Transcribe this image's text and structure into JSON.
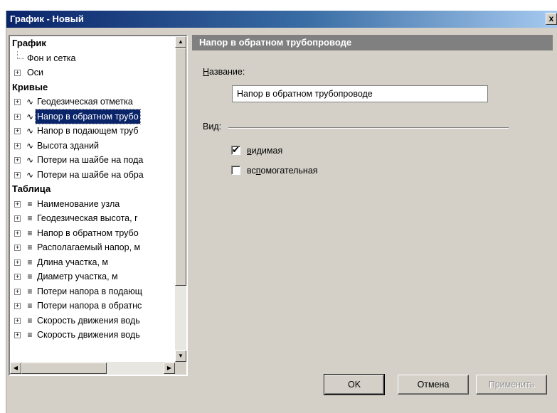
{
  "window": {
    "title": "График - Новый",
    "close_label": "x"
  },
  "tree": {
    "rows": [
      {
        "kind": "head",
        "label": "График"
      },
      {
        "kind": "leaf",
        "label": "Фон и сетка"
      },
      {
        "kind": "node",
        "icon": "",
        "label": "Оси"
      },
      {
        "kind": "head",
        "label": "Кривые"
      },
      {
        "kind": "node",
        "icon": "curve-icon",
        "label": "Геодезическая отметка"
      },
      {
        "kind": "node",
        "icon": "curve-icon",
        "label": "Напор в обратном трубо",
        "selected": true
      },
      {
        "kind": "node",
        "icon": "curve-icon",
        "label": "Напор в подающем труб"
      },
      {
        "kind": "node",
        "icon": "curve-icon",
        "label": "Высота зданий"
      },
      {
        "kind": "node",
        "icon": "curve-icon",
        "label": "Потери на шайбе на пода"
      },
      {
        "kind": "node",
        "icon": "curve-icon",
        "label": "Потери на шайбе на обра"
      },
      {
        "kind": "head",
        "label": "Таблица"
      },
      {
        "kind": "node",
        "icon": "table-row-icon",
        "label": "Наименование узла"
      },
      {
        "kind": "node",
        "icon": "table-row-icon",
        "label": "Геодезическая высота, r"
      },
      {
        "kind": "node",
        "icon": "table-row-icon",
        "label": "Напор в обратном трубо"
      },
      {
        "kind": "node",
        "icon": "table-row-icon",
        "label": "Располагаемый напор, м"
      },
      {
        "kind": "node",
        "icon": "table-row-icon",
        "label": "Длина участка, м"
      },
      {
        "kind": "node",
        "icon": "table-row-icon",
        "label": "Диаметр участка, м"
      },
      {
        "kind": "node",
        "icon": "table-row-icon",
        "label": "Потери напора в подающ"
      },
      {
        "kind": "node",
        "icon": "table-row-icon",
        "label": "Потери напора в обратнс"
      },
      {
        "kind": "node",
        "icon": "table-row-icon",
        "label": "Скорость движения водь"
      },
      {
        "kind": "node",
        "icon": "table-row-icon",
        "label": "Скорость движения водь"
      }
    ]
  },
  "panel": {
    "header": "Напор в обратном трубопроводе",
    "name_label_underlined": "Н",
    "name_label_rest": "азвание:",
    "name_value": "Напор в обратном трубопроводе",
    "view_label": "Вид:",
    "visible_label_underlined": "в",
    "visible_label_rest": "идимая",
    "visible_checked": true,
    "aux_label_pre": "вс",
    "aux_label_underlined": "п",
    "aux_label_rest": "омогательная",
    "aux_checked": false
  },
  "buttons": {
    "ok": "OK",
    "cancel": "Отмена",
    "apply": "Применить"
  }
}
